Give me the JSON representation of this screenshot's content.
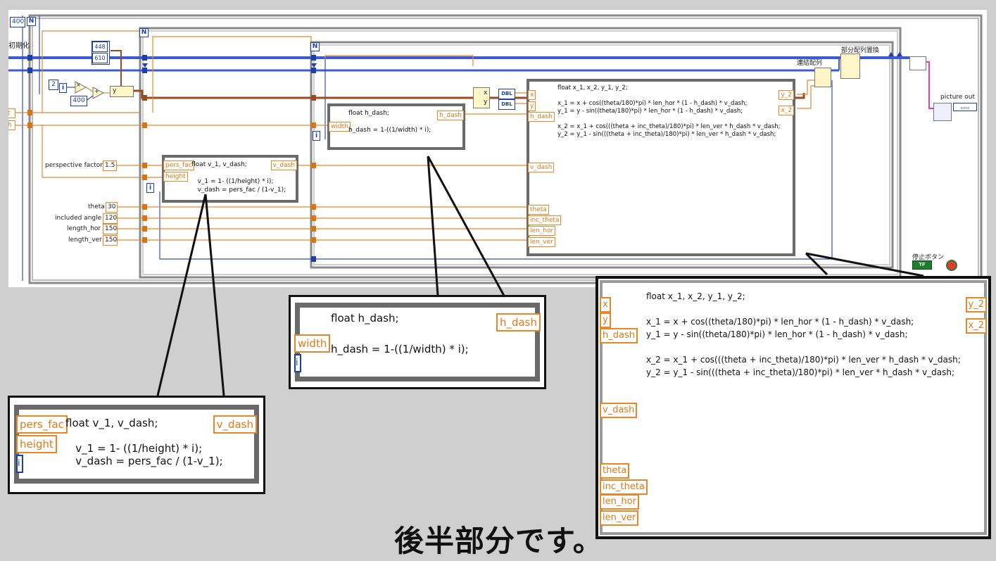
{
  "diagram": {
    "iter_count": "400",
    "init_label": "初期化",
    "size_width": "448",
    "size_height": "610",
    "const_two": "2",
    "const_400": "400",
    "y_label": "y",
    "n_label": "N",
    "i_label": "i",
    "inputs": [
      {
        "label": "perspective factor",
        "value": "1.5"
      },
      {
        "label": "theta",
        "value": "30"
      },
      {
        "label": "included angle",
        "value": "120"
      },
      {
        "label": "length_hor",
        "value": "150"
      },
      {
        "label": "length_ver",
        "value": "150"
      }
    ],
    "node_v": {
      "inputs": [
        "pers_fac",
        "height"
      ],
      "output": "v_dash",
      "code": "float v_1, v_dash;\n\n   v_1 = 1- ((1/height) * i);\n   v_dash = pers_fac / (1-v_1);"
    },
    "node_h": {
      "input": "width",
      "output": "h_dash",
      "code": "float h_dash;\n\nh_dash = 1-((1/width) * i);"
    },
    "node_xy": {
      "inputs": [
        "x",
        "y",
        "h_dash",
        "v_dash",
        "theta",
        "inc_theta",
        "len_hor",
        "len_ver"
      ],
      "outputs": [
        "y_2",
        "x_2"
      ],
      "code": "float x_1, x_2, y_1, y_2;\n\nx_1 = x + cos((theta/180)*pi) * len_hor * (1 - h_dash) * v_dash;\ny_1 = y - sin((theta/180)*pi) * len_hor * (1 - h_dash) * v_dash;\n\nx_2 = x_1 + cos(((theta + inc_theta)/180)*pi) * len_ver * h_dash * v_dash;\ny_2 = y_1 - sin(((theta + inc_theta)/180)*pi) * len_ver * h_dash * v_dash;"
    },
    "dbl_label": "DBL",
    "build_array_label": "連結配列",
    "replace_subset_label": "部分配列置換",
    "picture_out_label": "picture out",
    "stop_label": "停止ボタン",
    "stop_button": "TF"
  },
  "caption": "後半部分です。"
}
